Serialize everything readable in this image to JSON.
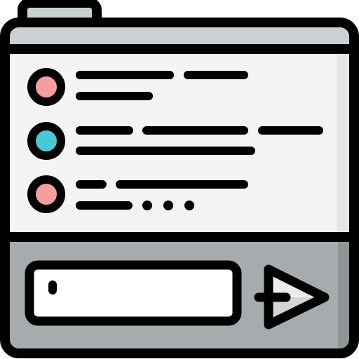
{
  "illustration": {
    "subject": "chat-window-icon",
    "colors": {
      "outline": "#000000",
      "tab": "#c9d1d3",
      "title_bar": "#c9d1d3",
      "content_bg": "#f4f4f4",
      "content_shade": "#e6e6e6",
      "footer_bg": "#a6acad",
      "footer_shade": "#8f9596",
      "input_bg": "#ffffff",
      "send_button": "#ececec",
      "send_button_shade": "#d5d5d5",
      "avatar_pink": "#f59e9e",
      "avatar_teal": "#4cc7d8"
    },
    "messages": [
      {
        "avatar_color": "pink",
        "text_lines": 2,
        "typing_dots": 0
      },
      {
        "avatar_color": "teal",
        "text_lines": 2,
        "typing_dots": 0
      },
      {
        "avatar_color": "pink",
        "text_lines": 2,
        "typing_dots": 3
      }
    ],
    "icons": [
      "chat-window-icon",
      "send-arrow-icon"
    ]
  }
}
